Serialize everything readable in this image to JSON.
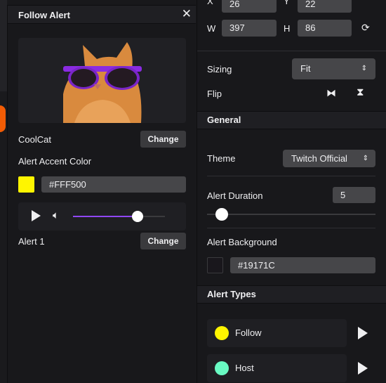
{
  "dialog": {
    "title": "Follow Alert",
    "close_icon": "close-icon",
    "image_name": "CoolCat",
    "change_label": "Change",
    "accent_label": "Alert Accent Color",
    "accent_color": "#FFF500",
    "accent_value": "#FFF500",
    "sound_name": "Alert 1",
    "volume_percent": 70,
    "volume_color": "#9147ff"
  },
  "properties": {
    "x_label": "X",
    "x_value": "26",
    "y_label": "Y",
    "y_value": "22",
    "w_label": "W",
    "w_value": "397",
    "h_label": "H",
    "h_value": "86",
    "sizing_label": "Sizing",
    "sizing_value": "Fit",
    "flip_label": "Flip"
  },
  "general": {
    "title": "General",
    "theme_label": "Theme",
    "theme_value": "Twitch Official",
    "duration_label": "Alert Duration",
    "duration_value": "5",
    "duration_slider_fraction": 0.05,
    "background_label": "Alert Background",
    "background_color": "#19171C",
    "background_value": "#19171C"
  },
  "alert_types": {
    "title": "Alert Types",
    "items": [
      {
        "label": "Follow",
        "color": "#FFF500"
      },
      {
        "label": "Host",
        "color": "#69FAC3"
      }
    ]
  }
}
